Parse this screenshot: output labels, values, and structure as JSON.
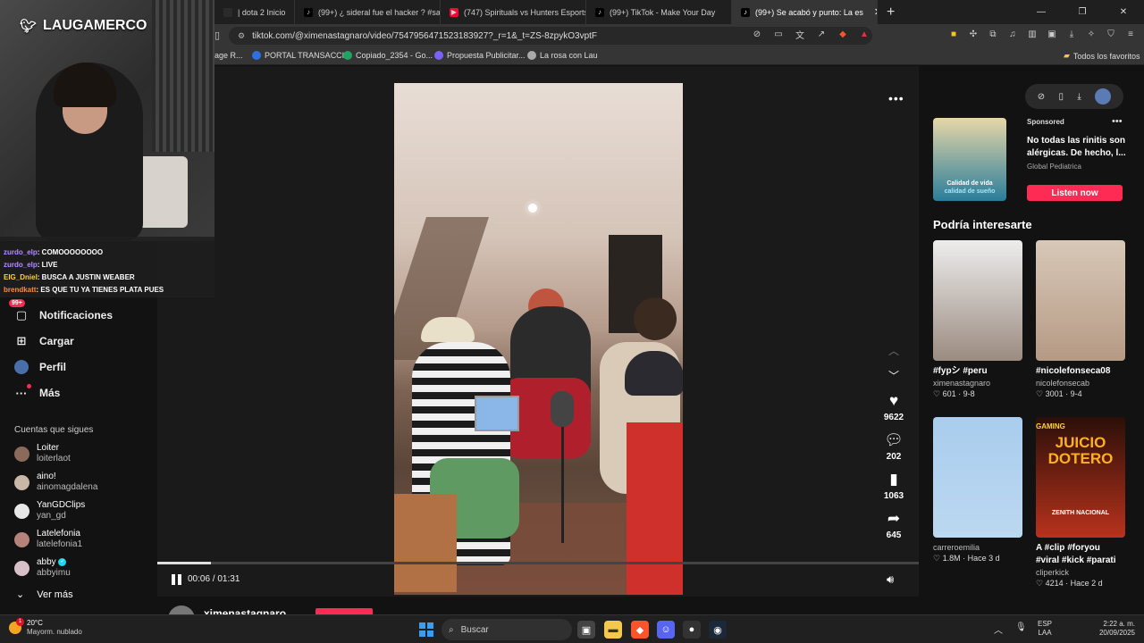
{
  "browser": {
    "tabs": [
      {
        "label": "| dota 2 Inicio",
        "icon": "",
        "color": "#2b2b2b"
      },
      {
        "label": "(99+) ¿ sideral fue el hacker ? #sandra",
        "icon": "♪",
        "color": "#000000"
      },
      {
        "label": "(747) Spirituals vs Hunters Esports | C",
        "icon": "▶",
        "color": "#ff0033"
      },
      {
        "label": "(99+) TikTok - Make Your Day",
        "icon": "♪",
        "color": "#000000"
      },
      {
        "label": "(99+) Se acabó y punto: La es",
        "icon": "♪",
        "color": "#000000",
        "active": true
      }
    ],
    "new_tab": "+",
    "url": "tiktok.com/@ximenastagnaro/video/7547956471523183927?_r=1&_t=ZS-8zpykO3vptF",
    "bookmarks": [
      {
        "label": "age R...",
        "color": "#6c6c6c"
      },
      {
        "label": "PORTAL TRANSACCI...",
        "color": "#2f6fe0"
      },
      {
        "label": "Copiado_2354 - Go...",
        "color": "#1fa463"
      },
      {
        "label": "Propuesta Publicitar...",
        "color": "#7b61ff"
      },
      {
        "label": "La rosa con Lau",
        "color": "#aaaaaa"
      }
    ],
    "all_bookmarks": "Todos los favoritos"
  },
  "stream": {
    "brand": "LAUGAMERCO",
    "chat": [
      {
        "user": "zurdo_elp",
        "text": ": COMOOOOOOOO",
        "cls": "u"
      },
      {
        "user": "zurdo_elp",
        "text": ": LIVE",
        "cls": "u"
      },
      {
        "user": "EIG_Dniel",
        "text": ": BUSCA A JUSTIN WEABER",
        "cls": "u2"
      },
      {
        "user": "brendkatt",
        "text": ": ES QUE TU YA TIENES PLATA PUES",
        "cls": "u3"
      }
    ]
  },
  "nav": {
    "notifications": "Notificaciones",
    "notifications_badge": "99+",
    "upload": "Cargar",
    "profile": "Perfil",
    "more": "Más",
    "following_title": "Cuentas que sigues",
    "accounts": [
      {
        "name": "Loiter",
        "handle": "loiterlaot",
        "color": "#8a6a5a"
      },
      {
        "name": "aino!",
        "handle": "ainomagdalena",
        "color": "#c9b7a8"
      },
      {
        "name": "YanGDClips",
        "handle": "yan_gd",
        "color": "#e8e8e8"
      },
      {
        "name": "Latelefonia",
        "handle": "latelefonia1",
        "color": "#b5837a"
      },
      {
        "name": "abby",
        "handle": "abbyimu",
        "color": "#d9c0c8",
        "verified": true
      }
    ],
    "see_more": "Ver más"
  },
  "player": {
    "time": "00:06 / 01:31",
    "progress": 0.07,
    "likes": "9622",
    "comments": "202",
    "saves": "1063",
    "shares": "645",
    "author": "ximenastagnaro"
  },
  "right": {
    "sponsored": "Sponsored",
    "ad_title": "No todas las rinitis son alérgicas. De hecho, l...",
    "ad_sub": "Global Pediatrica",
    "ad_caption_1": "Calidad de vida",
    "ad_caption_2": "calidad de sueño",
    "ad_button": "Listen now",
    "section": "Podría interesarte",
    "cards": [
      {
        "caption": "#fypシ #peru",
        "user": "ximenastagnaro",
        "meta": "♡ 601 · 9-8",
        "bg": "linear-gradient(180deg,#ededed,#9b8b80)"
      },
      {
        "caption": "#nicolefonseca08",
        "user": "nicolefonsecab",
        "meta": "♡ 3001 · 9-4",
        "bg": "linear-gradient(180deg,#d8c8b8,#b59a84)"
      },
      {
        "caption": "",
        "user": "carreroemilia",
        "meta": "♡ 1.8M · Hace 3 d",
        "bg": "linear-gradient(180deg,#a9cdee,#bcd8f0)"
      },
      {
        "caption": "A #clip #foryou #viral #kick #parati",
        "user": "cliperkick",
        "meta": "♡ 4214 · Hace 2 d",
        "bg": "linear-gradient(180deg,#2b0f08,#b8321c)"
      }
    ],
    "card4_overlay": "JUICIO DOTERO",
    "card4_tag": "GAMING",
    "card4_sub": "ZENITH NACIONAL"
  },
  "taskbar": {
    "temp": "20°C",
    "weather": "Mayorm. nublado",
    "weather_badge": "1",
    "search": "Buscar",
    "lang1": "ESP",
    "lang2": "LAA",
    "time": "2:22 a. m.",
    "date": "20/09/2025"
  }
}
